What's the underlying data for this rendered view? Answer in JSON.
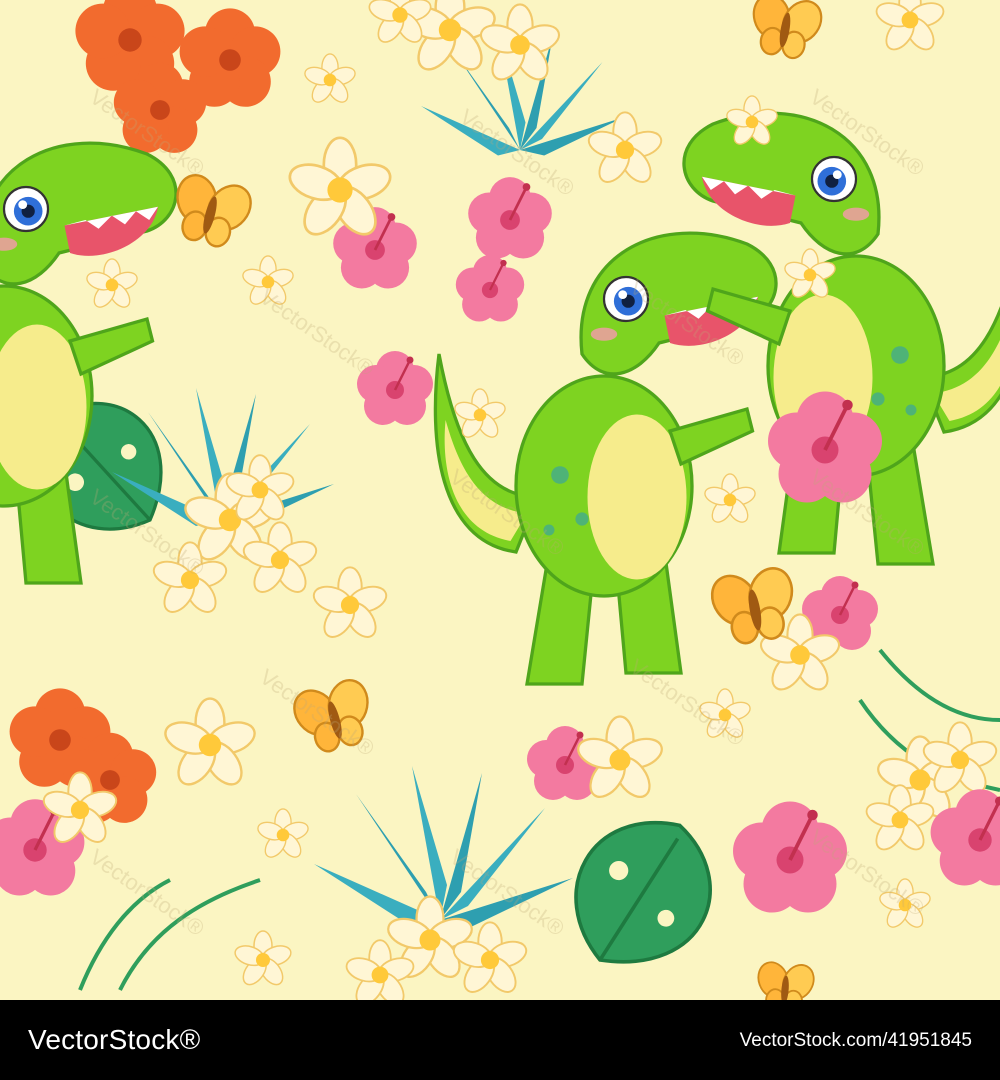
{
  "artwork": {
    "background_color": "#FBF5C2",
    "watermark_text": "VectorStock®"
  },
  "footer": {
    "brand": "VectorStock®",
    "image_id": "VectorStock.com/41951845"
  },
  "colors": {
    "dino_green": "#7ED321",
    "dino_dark": "#4FA51B",
    "belly": "#F6EC8C",
    "hibiscus_pink": "#F37AA0",
    "hibiscus_orange": "#F26B2E",
    "plumeria": "#FFF6D5",
    "plumeria_center": "#FFC93A",
    "leaf_teal": "#2E9FB0",
    "leaf_green": "#2F9E5C",
    "butterfly": "#FFB53A"
  }
}
